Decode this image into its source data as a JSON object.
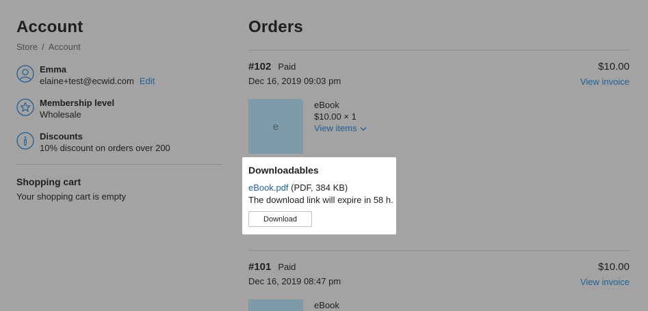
{
  "account": {
    "title": "Account",
    "breadcrumb": [
      "Store",
      "Account"
    ],
    "breadcrumb_sep": "/",
    "profile": {
      "name": "Emma",
      "email": "elaine+test@ecwid.com",
      "edit_label": "Edit",
      "icon": "user-icon"
    },
    "membership": {
      "label": "Membership level",
      "value": "Wholesale",
      "icon": "star-icon"
    },
    "discounts": {
      "label": "Discounts",
      "value": "10% discount on orders over 200",
      "icon": "info-icon"
    },
    "cart": {
      "title": "Shopping cart",
      "status": "Your shopping cart is empty"
    }
  },
  "orders": {
    "title": "Orders",
    "list": [
      {
        "number": "#102",
        "status": "Paid",
        "date": "Dec 16, 2019 09:03 pm",
        "total": "$10.00",
        "invoice_label": "View invoice",
        "item": {
          "thumb_letter": "e",
          "name": "eBook",
          "price": "$10.00 × 1",
          "view_items_label": "View items"
        }
      },
      {
        "number": "#101",
        "status": "Paid",
        "date": "Dec 16, 2019 08:47 pm",
        "total": "$10.00",
        "invoice_label": "View invoice",
        "item": {
          "name": "eBook"
        }
      }
    ]
  },
  "downloadables": {
    "title": "Downloadables",
    "file_link": "eBook.pdf",
    "file_meta": "(PDF, 384 KB)",
    "expire_text": "The download link will expire in 58 h.",
    "button_label": "Download"
  },
  "colors": {
    "background": "#a3a3a3",
    "link": "#1f5f95",
    "card": "#ffffff",
    "thumb": "#7f9aa9"
  }
}
